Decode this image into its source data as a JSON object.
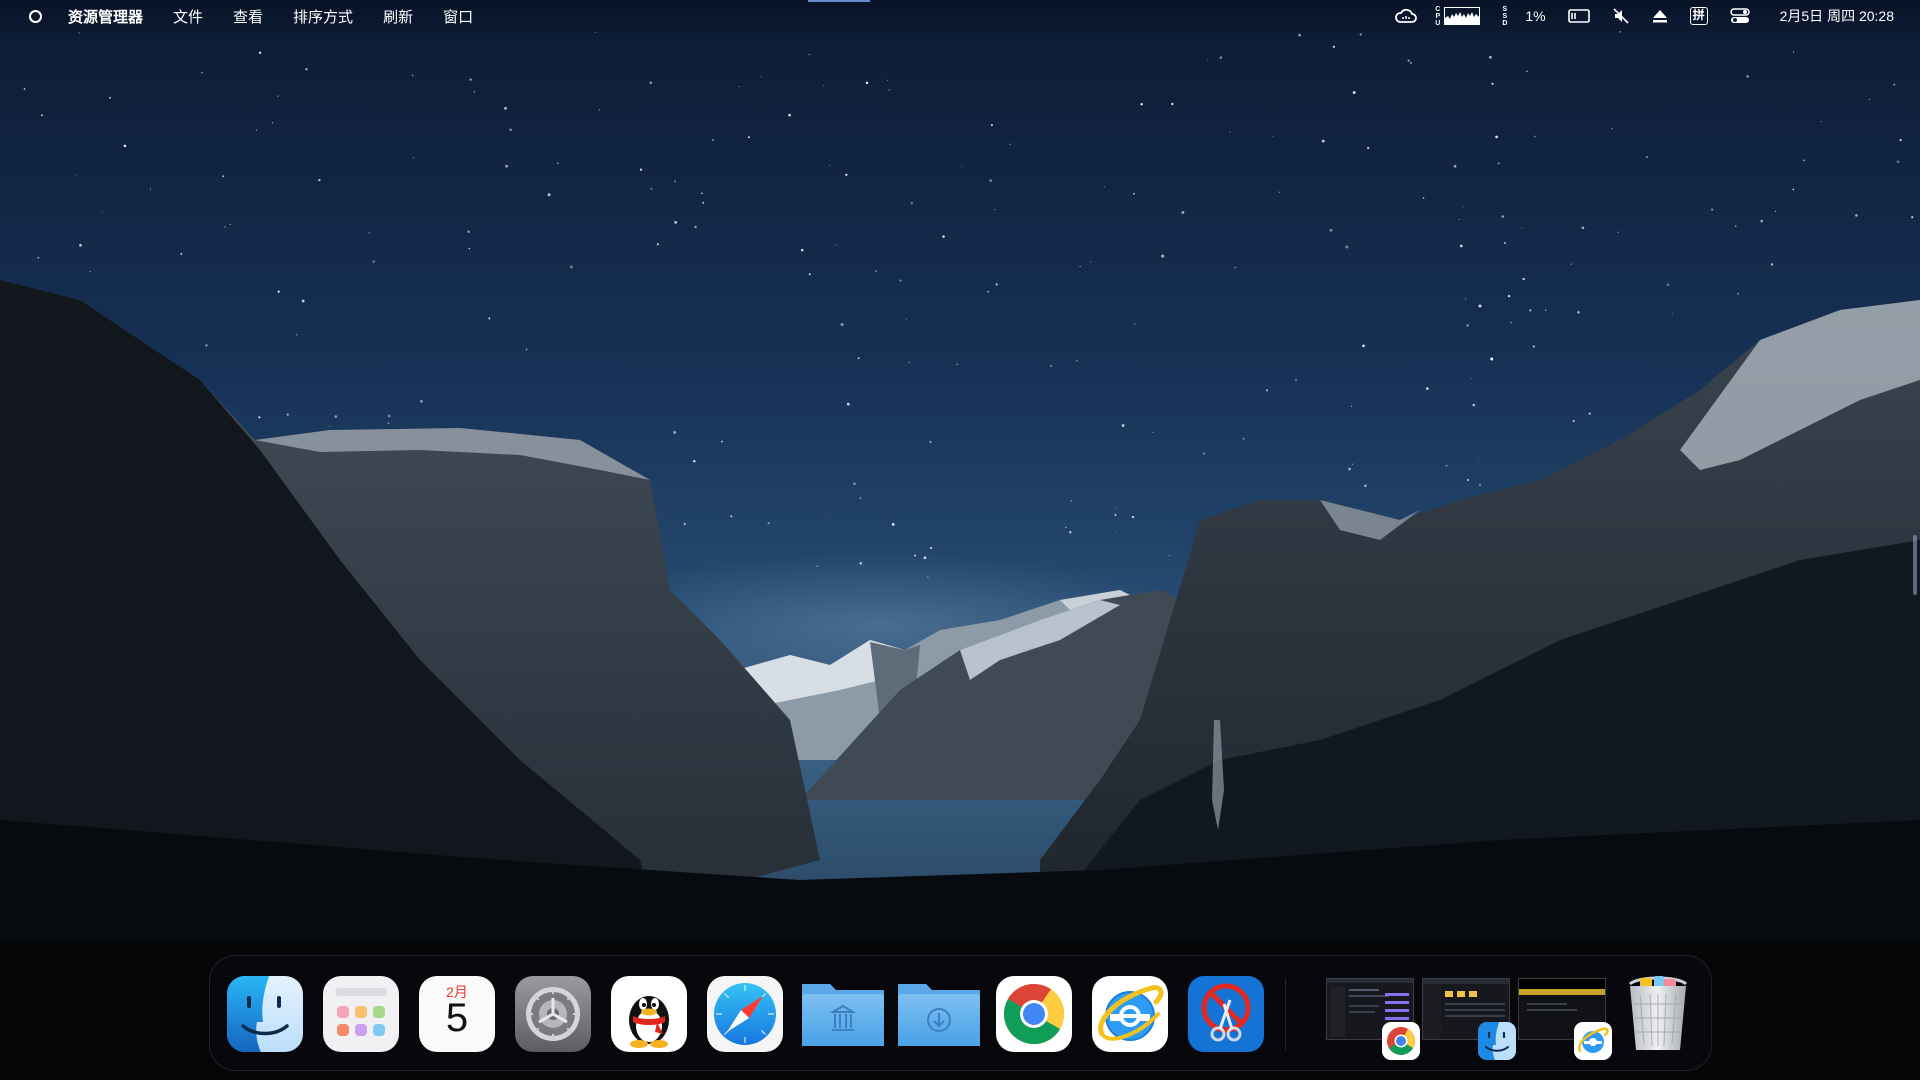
{
  "menubar": {
    "logo_icon": "circle-logo-icon",
    "app_name": "资源管理器",
    "items": [
      "文件",
      "查看",
      "排序方式",
      "刷新",
      "窗口"
    ]
  },
  "tray": {
    "cpu_label_top": "C",
    "cpu_label_mid": "P",
    "cpu_label_bot": "U",
    "ssd_label_top": "S",
    "ssd_label_mid": "S",
    "ssd_label_bot": "D",
    "percent": "1%",
    "ime": "拼",
    "datetime": "2月5日 周四 20:28"
  },
  "dock": {
    "apps": [
      {
        "name": "Finder",
        "icon": "finder-icon"
      },
      {
        "name": "Launchpad",
        "icon": "launchpad-icon"
      },
      {
        "name": "Calendar",
        "icon": "calendar-icon"
      },
      {
        "name": "System Preferences",
        "icon": "gear-icon"
      },
      {
        "name": "QQ",
        "icon": "qq-penguin-icon"
      },
      {
        "name": "Safari",
        "icon": "compass-icon"
      },
      {
        "name": "Applications",
        "icon": "applications-folder-icon"
      },
      {
        "name": "Downloads",
        "icon": "downloads-folder-icon"
      },
      {
        "name": "Chrome",
        "icon": "chrome-icon"
      },
      {
        "name": "Internet Explorer",
        "icon": "ie-icon"
      },
      {
        "name": "Tool",
        "icon": "scissors-tool-icon"
      }
    ],
    "calendar": {
      "month": "2月",
      "day": "5"
    },
    "minimized": [
      {
        "name": "chrome-window",
        "badge": "chrome-icon"
      },
      {
        "name": "finder-window",
        "badge": "finder-icon"
      },
      {
        "name": "ie-window",
        "badge": "ie-icon"
      }
    ],
    "trash_icon": "trash-icon"
  },
  "colors": {
    "sky_top": "#0d1b35",
    "sky_mid": "#1f3f66",
    "accent": "#6a8ccf"
  }
}
